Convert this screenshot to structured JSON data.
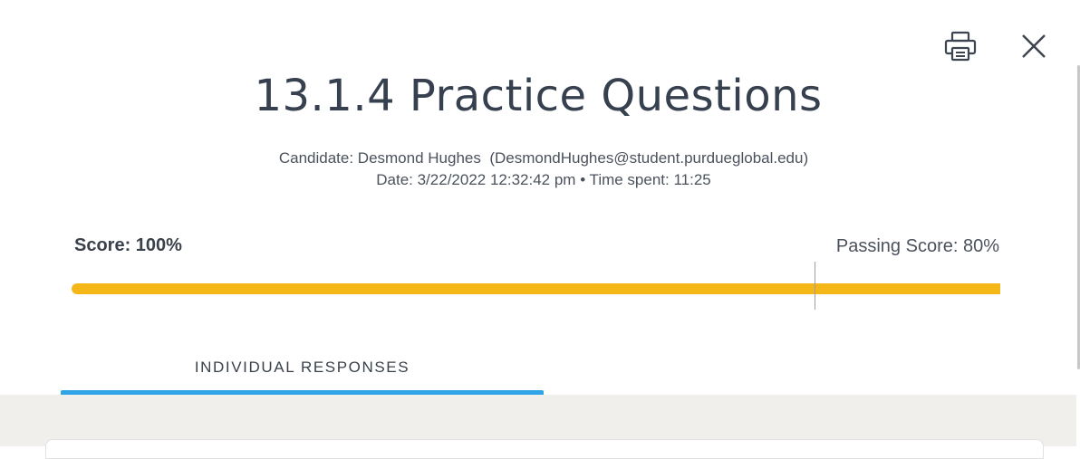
{
  "header": {
    "print_icon": "printer-icon",
    "close_icon": "close-icon",
    "title": "13.1.4 Practice Questions",
    "candidate_line": "Candidate: Desmond Hughes  (DesmondHughes@student.purdueglobal.edu)",
    "date_line": "Date: 3/22/2022 12:32:42 pm • Time spent: 11:25"
  },
  "score": {
    "label": "Score: 100%",
    "value": 1.0,
    "passing_label": "Passing Score: 80%",
    "passing_value": 0.8,
    "bar_color": "#f5b617"
  },
  "tabs": [
    {
      "label": "INDIVIDUAL RESPONSES",
      "active": true,
      "accent": "#2fa4e7"
    }
  ]
}
